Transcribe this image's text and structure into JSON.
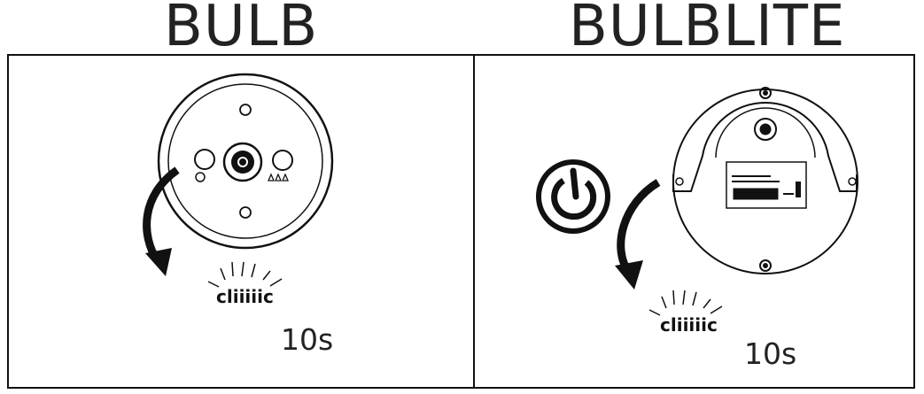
{
  "panels": {
    "left": {
      "title": "BULB",
      "sound_text": "cliiiiic",
      "duration": "10s"
    },
    "right": {
      "title": "BULBLITE",
      "sound_text": "cliiiiic",
      "duration": "10s"
    }
  },
  "icons": [
    "power-icon",
    "arrow-icon",
    "bulb-device-icon",
    "bulblite-device-icon"
  ]
}
